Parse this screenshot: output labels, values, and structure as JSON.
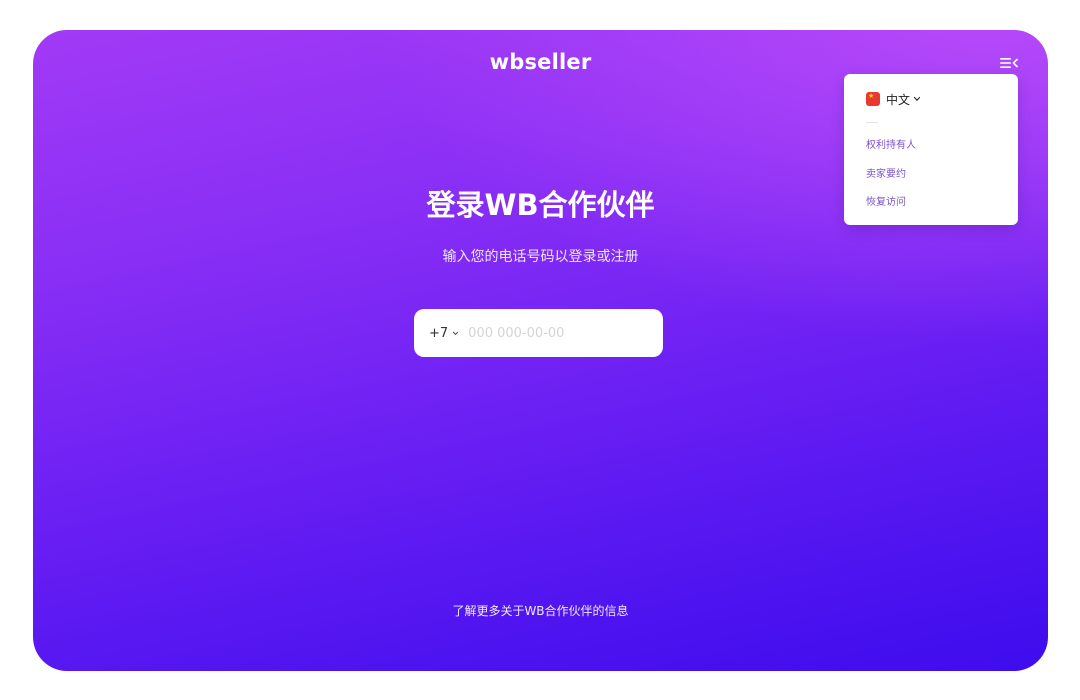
{
  "header": {
    "logo_text": "wbseller",
    "menu_icon": "menu-icon"
  },
  "menu": {
    "language": {
      "flag_icon": "china-flag-icon",
      "label": "中文"
    },
    "items": [
      {
        "label": "权利持有人"
      },
      {
        "label": "卖家要约"
      },
      {
        "label": "恢复访问"
      }
    ]
  },
  "main": {
    "title": "登录WB合作伙伴",
    "subtitle": "输入您的电话号码以登录或注册",
    "phone": {
      "country_code": "+7",
      "placeholder": "000 000-00-00",
      "value": ""
    }
  },
  "footer": {
    "link_text": "了解更多关于WB合作伙伴的信息"
  },
  "colors": {
    "gradient_top": "#bb4cfa",
    "gradient_bottom": "#3e0ced",
    "link_purple": "#7b52c9",
    "flag_red": "#e8392f"
  }
}
